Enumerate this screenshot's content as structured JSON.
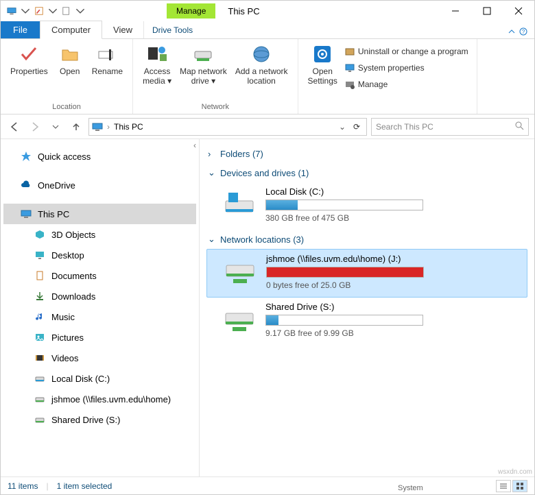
{
  "title": "This PC",
  "manage_label": "Manage",
  "tabs": {
    "file": "File",
    "computer": "Computer",
    "view": "View",
    "drivetools": "Drive Tools"
  },
  "ribbon": {
    "location": {
      "label": "Location",
      "properties": "Properties",
      "open": "Open",
      "rename": "Rename"
    },
    "network": {
      "label": "Network",
      "access": "Access media",
      "map": "Map network drive",
      "add": "Add a network location"
    },
    "system": {
      "label": "System",
      "settings": "Open Settings",
      "uninstall": "Uninstall or change a program",
      "props": "System properties",
      "manage": "Manage"
    }
  },
  "address": "This PC",
  "search_placeholder": "Search This PC",
  "nav": {
    "quick": "Quick access",
    "onedrive": "OneDrive",
    "thispc": "This PC",
    "items": [
      "3D Objects",
      "Desktop",
      "Documents",
      "Downloads",
      "Music",
      "Pictures",
      "Videos",
      "Local Disk (C:)",
      "jshmoe (\\\\files.uvm.edu\\home)",
      "Shared Drive (S:)"
    ]
  },
  "groups": {
    "folders": "Folders (7)",
    "devices": "Devices and drives (1)",
    "network": "Network locations (3)"
  },
  "drives": {
    "local": {
      "name": "Local Disk (C:)",
      "free": "380 GB free of 475 GB",
      "pct": 20
    },
    "net1": {
      "name": "jshmoe (\\\\files.uvm.edu\\home) (J:)",
      "free": "0 bytes free of 25.0 GB",
      "pct": 100
    },
    "net2": {
      "name": "Shared Drive (S:)",
      "free": "9.17 GB free of 9.99 GB",
      "pct": 8
    }
  },
  "status": {
    "count": "11 items",
    "sel": "1 item selected"
  },
  "watermark": "wsxdn.com"
}
